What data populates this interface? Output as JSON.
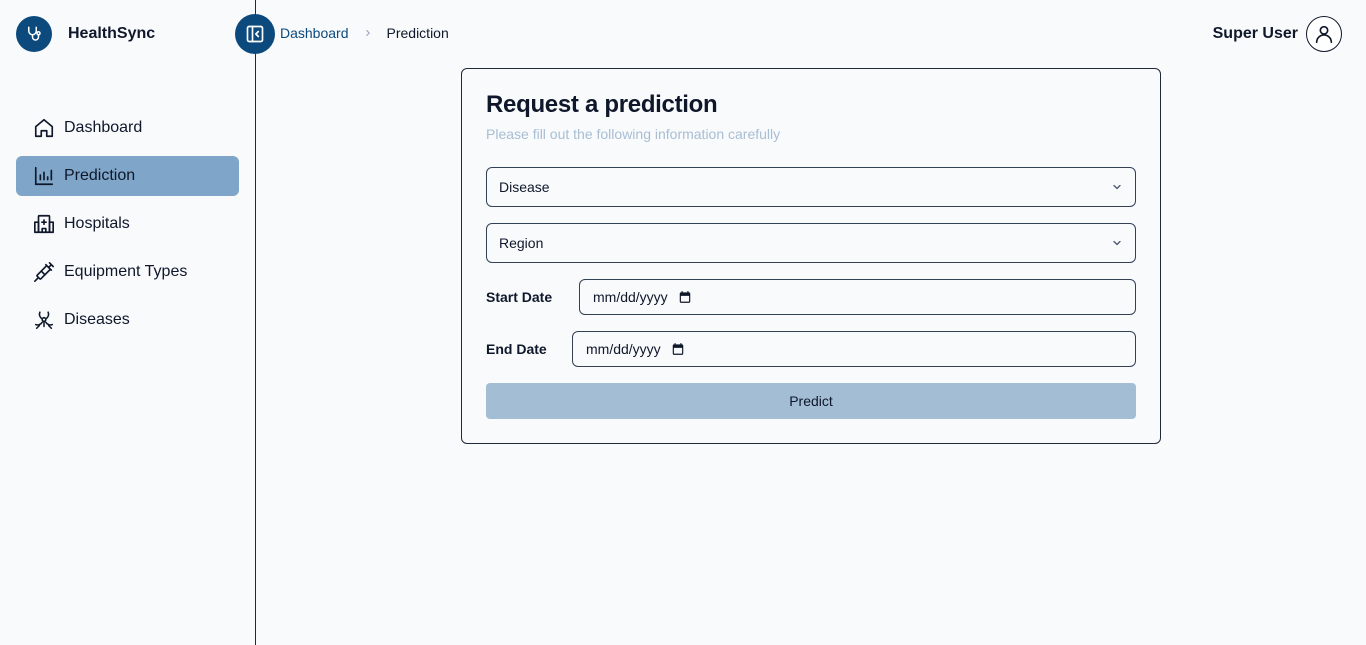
{
  "app": {
    "name": "HealthSync",
    "logo_icon": "stethoscope-icon",
    "accent_color": "#0c4a7e",
    "active_color": "#7fa5c9"
  },
  "sidebar": {
    "items": [
      {
        "label": "Dashboard",
        "icon": "home-icon",
        "active": false
      },
      {
        "label": "Prediction",
        "icon": "bar-chart-icon",
        "active": true
      },
      {
        "label": "Hospitals",
        "icon": "hospital-icon",
        "active": false
      },
      {
        "label": "Equipment Types",
        "icon": "syringe-icon",
        "active": false
      },
      {
        "label": "Diseases",
        "icon": "biohazard-icon",
        "active": false
      }
    ]
  },
  "header": {
    "collapse_icon": "panel-collapse-icon",
    "breadcrumb": {
      "link": "Dashboard",
      "current": "Prediction"
    },
    "user": {
      "name": "Super User",
      "icon": "user-icon"
    }
  },
  "form": {
    "title": "Request a prediction",
    "subtitle": "Please fill out the following information carefully",
    "disease_select": {
      "value": "Disease"
    },
    "region_select": {
      "value": "Region"
    },
    "start_date": {
      "label": "Start Date",
      "placeholder": "mm/dd/yyyy"
    },
    "end_date": {
      "label": "End Date",
      "placeholder": "mm/dd/yyyy"
    },
    "submit_label": "Predict"
  }
}
